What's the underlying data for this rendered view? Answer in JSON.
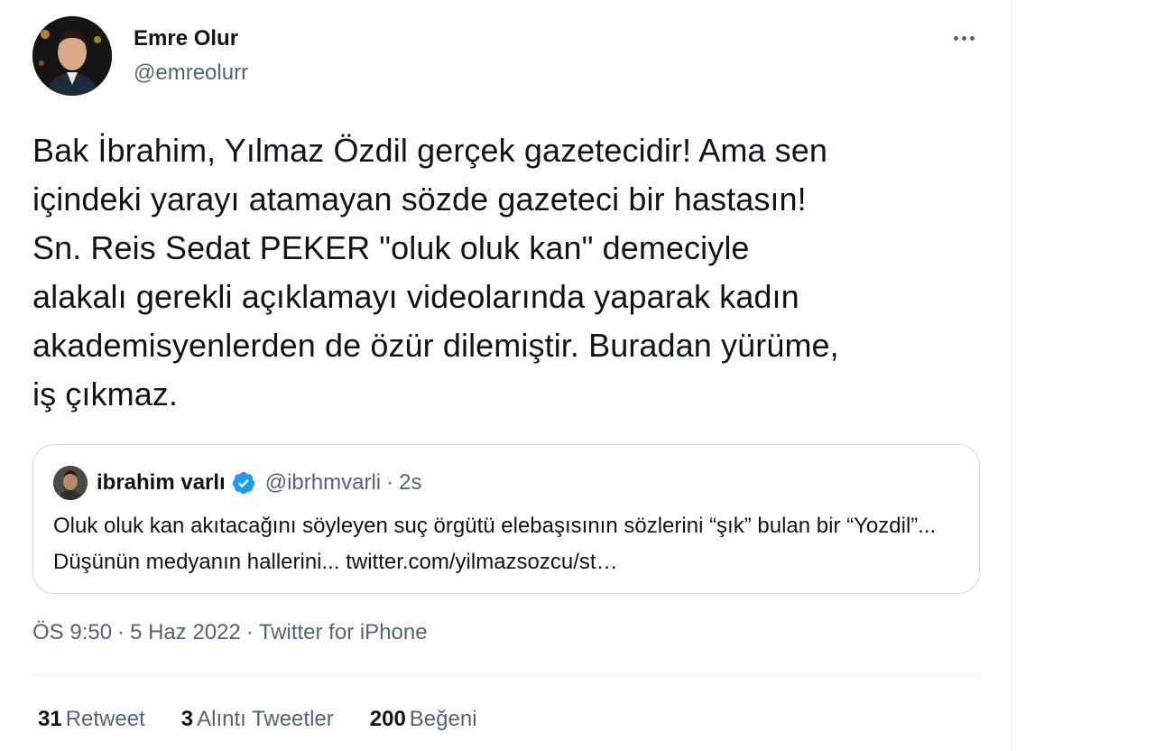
{
  "author": {
    "display_name": "Emre Olur",
    "handle": "@emreolurr"
  },
  "more_icon": "more-horizontal-icon",
  "tweet": {
    "text": "Bak İbrahim, Yılmaz Özdil gerçek gazetecidir! Ama sen\niçindeki yarayı atamayan sözde gazeteci bir hastasın!\nSn. Reis Sedat PEKER \"oluk oluk kan\" demeciyle\nalakalı gerekli açıklamayı videolarında yaparak kadın\nakademisyenlerden de özür dilemiştir. Buradan yürüme,\niş çıkmaz."
  },
  "quote": {
    "name": "ibrahim varlı",
    "verified_icon": "verified-badge-icon",
    "handle": "@ibrhmvarli",
    "separator": "·",
    "time": "2s",
    "text": "Oluk oluk kan akıtacağını söyleyen suç örgütü elebaşısının sözlerini “şık” bulan bir “Yozdil”... Düşünün medyanın hallerini... twitter.com/yilmazsozcu/st…"
  },
  "meta": {
    "time": "ÖS 9:50",
    "separator": "·",
    "date": "5 Haz 2022",
    "source": "Twitter for iPhone"
  },
  "stats": {
    "retweets": {
      "count": "31",
      "label": "Retweet"
    },
    "quotes": {
      "count": "3",
      "label": "Alıntı Tweetler"
    },
    "likes": {
      "count": "200",
      "label": "Beğeni"
    }
  },
  "colors": {
    "text_primary": "#0f1419",
    "text_secondary": "#536471",
    "border": "#cfd9de",
    "verified": "#1d9bf0"
  }
}
